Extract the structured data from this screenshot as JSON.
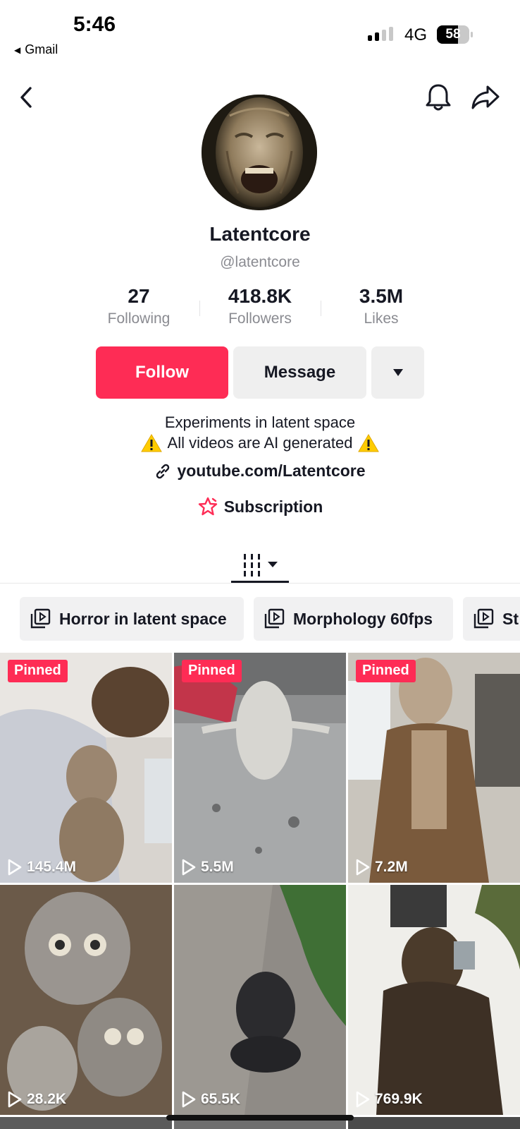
{
  "status_bar": {
    "time": "5:46",
    "back_app": "Gmail",
    "network": "4G",
    "battery": "58"
  },
  "profile": {
    "name": "Latentcore",
    "handle": "@latentcore",
    "stats": [
      {
        "value": "27",
        "label": "Following"
      },
      {
        "value": "418.8K",
        "label": "Followers"
      },
      {
        "value": "3.5M",
        "label": "Likes"
      }
    ],
    "actions": {
      "follow": "Follow",
      "message": "Message"
    },
    "bio_line1": "Experiments in latent space",
    "bio_line2": "All videos are AI generated",
    "link": "youtube.com/Latentcore",
    "subscription": "Subscription"
  },
  "playlists": [
    "Horror in latent space",
    "Morphology 60fps",
    "St"
  ],
  "videos": [
    {
      "views": "145.4M",
      "pinned": "Pinned"
    },
    {
      "views": "5.5M",
      "pinned": "Pinned"
    },
    {
      "views": "7.2M",
      "pinned": "Pinned"
    },
    {
      "views": "28.2K"
    },
    {
      "views": "65.5K"
    },
    {
      "views": "769.9K"
    }
  ],
  "colors": {
    "accent": "#fe2c55",
    "text": "#161823",
    "muted": "#8a8b91",
    "button_gray": "#efefef"
  }
}
